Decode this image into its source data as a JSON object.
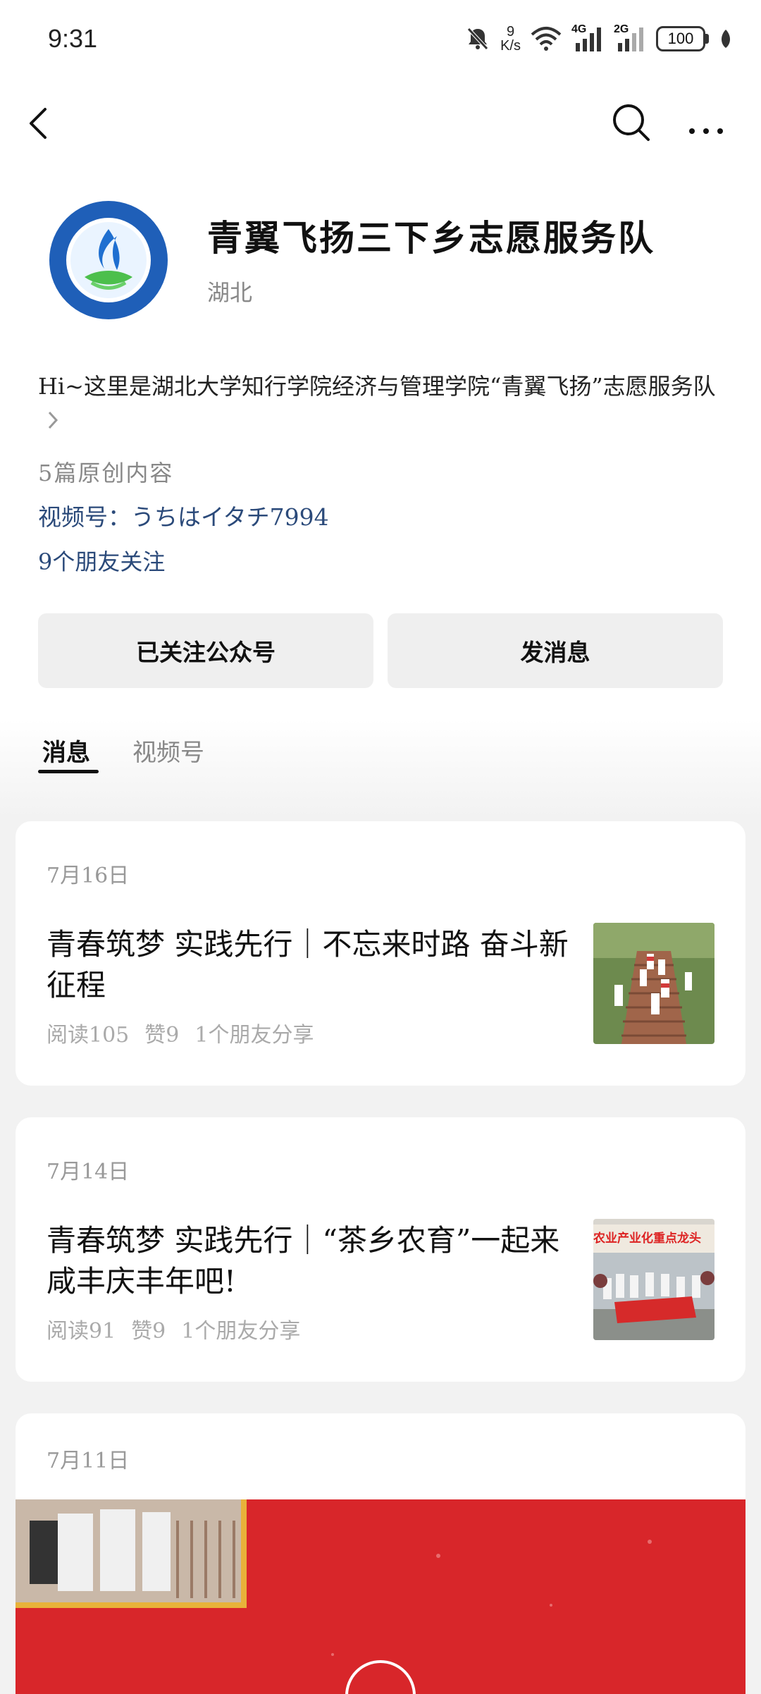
{
  "status_bar": {
    "time": "9:31",
    "speed_value": "9",
    "speed_unit": "K/s",
    "net1": "4G",
    "net2": "2G",
    "battery": "100"
  },
  "profile": {
    "name": "青翼飞扬三下乡志愿服务队",
    "region": "湖北",
    "intro": "Hi~这里是湖北大学知行学院经济与管理学院“青翼飞扬”志愿服务队",
    "original_count": "5篇原创内容",
    "channel": "视频号：うちはイタチ7994",
    "friends_following": "9个朋友关注"
  },
  "actions": {
    "follow_label": "已关注公众号",
    "message_label": "发消息"
  },
  "tabs": [
    {
      "label": "消息",
      "active": true
    },
    {
      "label": "视频号",
      "active": false
    }
  ],
  "articles": [
    {
      "date": "7月16日",
      "title": "青春筑梦  实践先行｜不忘来时路  奋斗新征程",
      "reads": "阅读105",
      "likes": "赞9",
      "shares": "1个朋友分享",
      "thumb_icon": "group-on-stairs-photo"
    },
    {
      "date": "7月14日",
      "title": "青春筑梦 实践先行｜“茶乡农育”一起来咸丰庆丰年吧!",
      "reads": "阅读91",
      "likes": "赞9",
      "shares": "1个朋友分享",
      "thumb_banner_text": "农业产业化重点龙头",
      "thumb_icon": "group-with-banner-photo"
    },
    {
      "date": "7月11日",
      "video_icon": "play-icon"
    }
  ],
  "colors": {
    "accent_link": "#2b4a7a",
    "card_bg": "#ffffff",
    "page_bg": "#f2f2f2",
    "video_red": "#d8262a"
  }
}
